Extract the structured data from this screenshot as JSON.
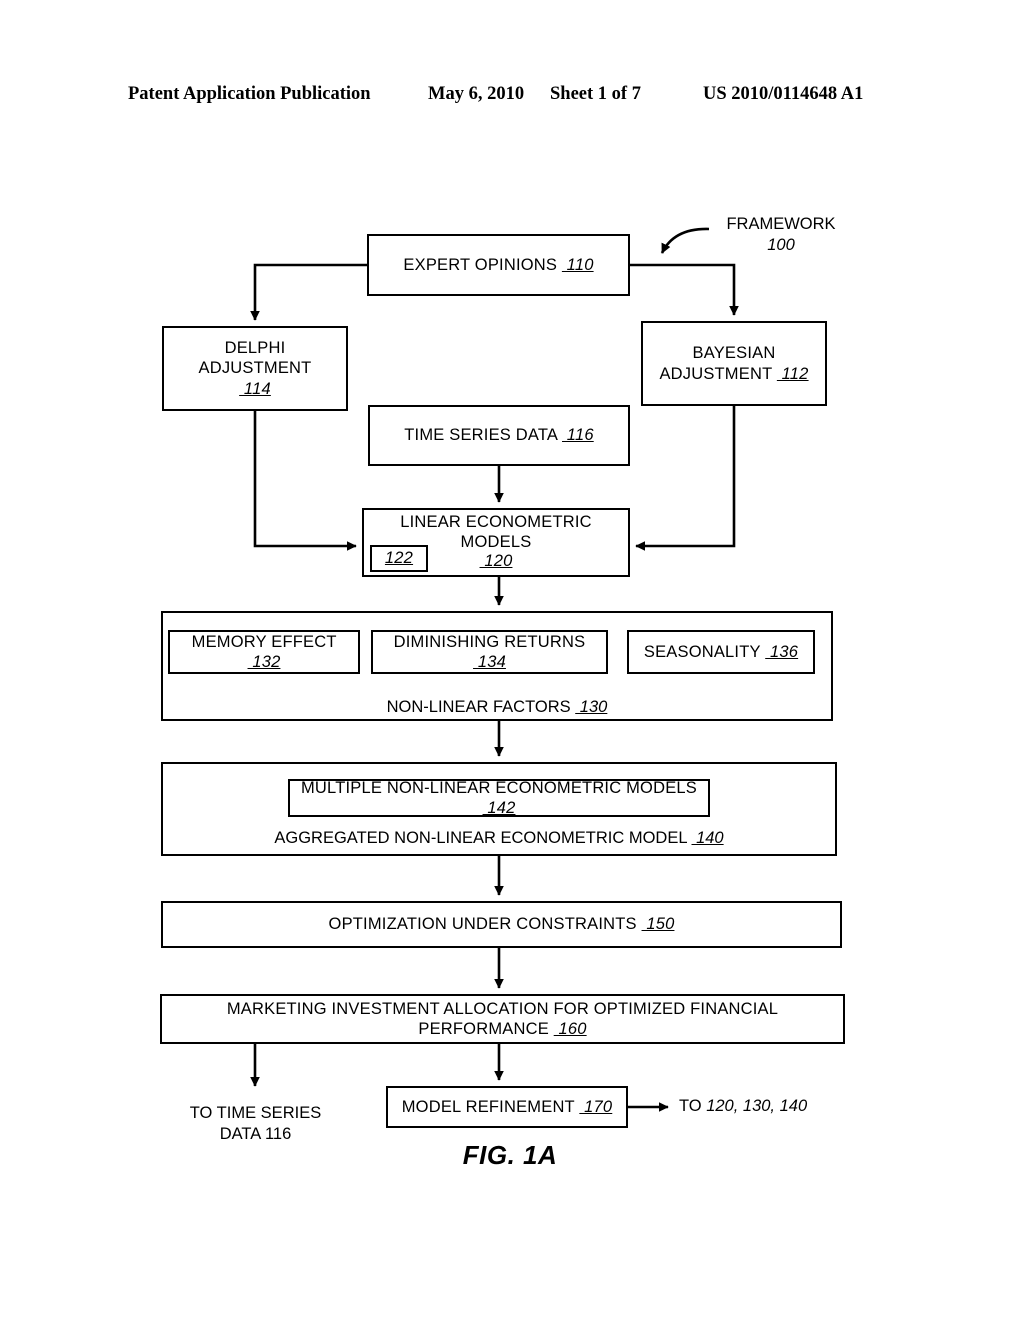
{
  "header": {
    "title": "Patent Application Publication",
    "date": "May 6, 2010",
    "sheet": "Sheet 1 of 7",
    "number": "US 2010/0114648 A1"
  },
  "figure": {
    "caption": "FIG. 1A",
    "framework": {
      "label": "FRAMEWORK",
      "ref": "100"
    },
    "nodes": {
      "expert_opinions": {
        "label": "EXPERT OPINIONS",
        "ref": "110"
      },
      "delphi_adjustment": {
        "label": "DELPHI ADJUSTMENT",
        "ref": "114"
      },
      "bayesian_adjustment_line1": "BAYESIAN",
      "bayesian_adjustment": {
        "label": "ADJUSTMENT",
        "ref": "112"
      },
      "time_series_data": {
        "label": "TIME SERIES DATA",
        "ref": "116"
      },
      "linear_models": {
        "label": "LINEAR ECONOMETRIC MODELS",
        "ref": "120"
      },
      "linear_models_inner_ref": "122",
      "memory_effect": {
        "label": "MEMORY EFFECT",
        "ref": "132"
      },
      "diminishing_returns": {
        "label": "DIMINISHING RETURNS",
        "ref": "134"
      },
      "seasonality": {
        "label": "SEASONALITY",
        "ref": "136"
      },
      "non_linear_factors": {
        "label": "NON-LINEAR FACTORS",
        "ref": "130"
      },
      "multiple_models": {
        "label": "MULTIPLE NON-LINEAR ECONOMETRIC MODELS",
        "ref": "142"
      },
      "aggregated_model": {
        "label": "AGGREGATED NON-LINEAR ECONOMETRIC MODEL",
        "ref": "140"
      },
      "optimization": {
        "label": "OPTIMIZATION UNDER CONSTRAINTS",
        "ref": "150"
      },
      "marketing_allocation": {
        "label": "MARKETING INVESTMENT ALLOCATION FOR OPTIMIZED FINANCIAL PERFORMANCE",
        "ref": "160"
      },
      "model_refinement": {
        "label": "MODEL REFINEMENT",
        "ref": "170"
      }
    },
    "annotations": {
      "to_time_series_line1": "TO TIME SERIES",
      "to_time_series_line2": "DATA 116",
      "to_models": "TO ",
      "to_models_refs": "120, 130, 140"
    }
  },
  "colors": {
    "ink": "#000000",
    "paper": "#ffffff"
  }
}
